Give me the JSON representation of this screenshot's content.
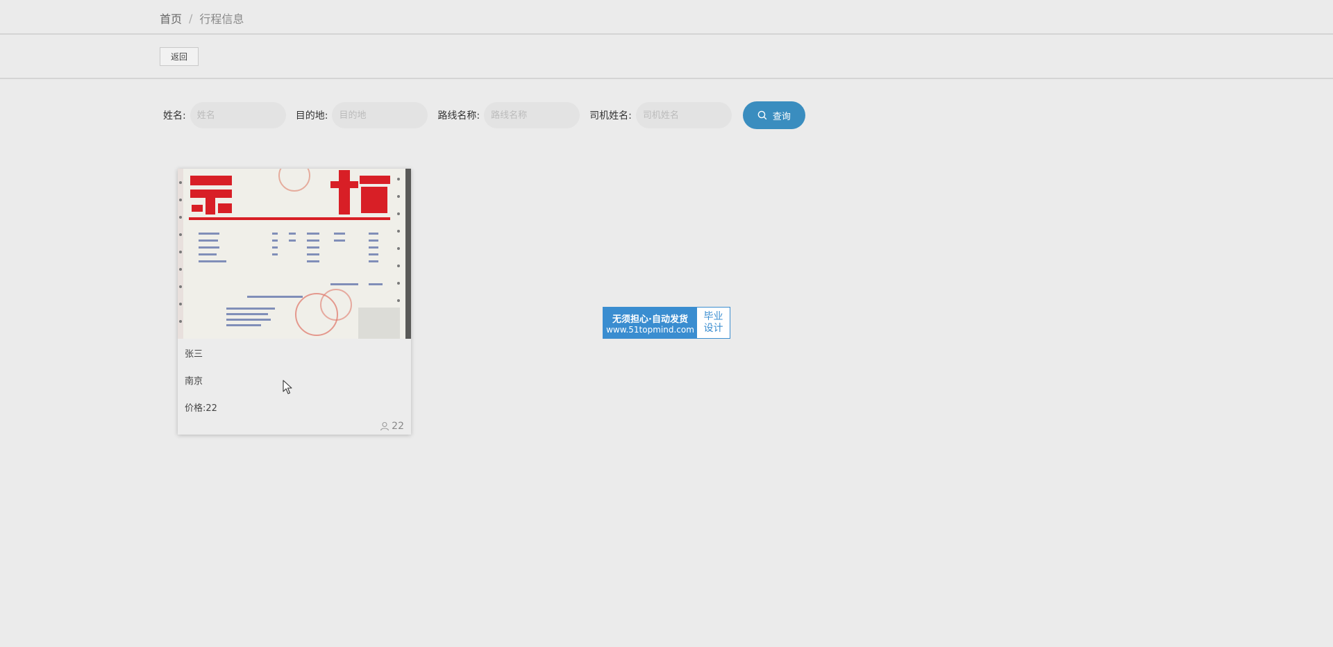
{
  "breadcrumb": {
    "home": "首页",
    "separator": "/",
    "current": "行程信息"
  },
  "toolbar": {
    "back_label": "返回"
  },
  "search": {
    "fields": [
      {
        "label": "姓名:",
        "placeholder": "姓名",
        "value": ""
      },
      {
        "label": "目的地:",
        "placeholder": "目的地",
        "value": ""
      },
      {
        "label": "路线名称:",
        "placeholder": "路线名称",
        "value": ""
      },
      {
        "label": "司机姓名:",
        "placeholder": "司机姓名",
        "value": ""
      }
    ],
    "query_label": "查询",
    "query_icon": "search-icon"
  },
  "cards": [
    {
      "image_desc": "receipt-photo",
      "name": "张三",
      "destination": "南京",
      "price": "价格:22",
      "likes": "22",
      "likes_icon": "user-icon"
    }
  ],
  "watermark": {
    "line1": "无须担心·自动发货",
    "line2": "www.51topmind.com",
    "badge_line1": "毕业",
    "badge_line2": "设计"
  },
  "colors": {
    "accent": "#3a8dbf",
    "background": "#ebebeb",
    "watermark_blue": "#3a8dd0"
  }
}
